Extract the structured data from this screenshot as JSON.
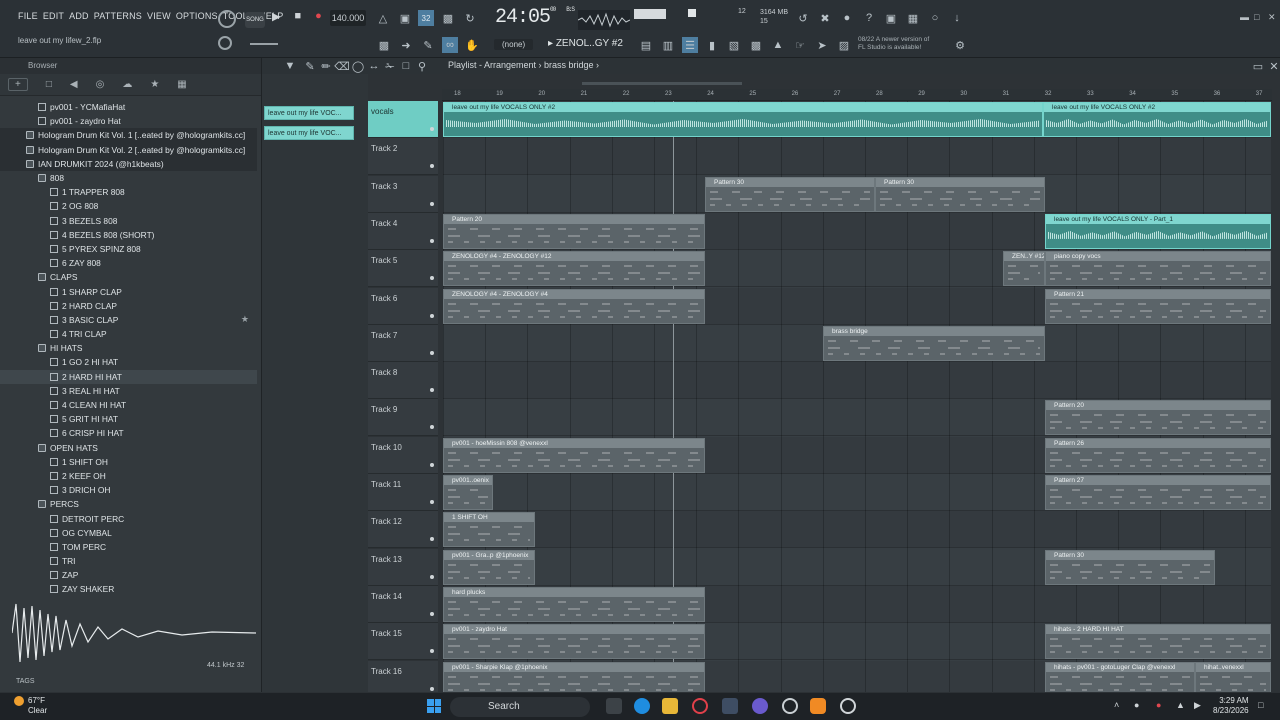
{
  "menu": [
    "FILE",
    "EDIT",
    "ADD",
    "PATTERNS",
    "VIEW",
    "OPTIONS",
    "TOOLS",
    "HELP"
  ],
  "hint_text": "leave out my lifew_2.flp",
  "song_mode_label": "SONG",
  "tempo": "140.000",
  "clock": {
    "main": "24:05",
    "sub": "00",
    "unit": "B:S"
  },
  "cpu": {
    "value": "12",
    "memory": "3164 MB",
    "count": "15"
  },
  "pattern_selector": "ZENOL..GY #2",
  "none_selector": "(none)",
  "news_text": [
    "08/22  A newer version of",
    "FL Studio is available!"
  ],
  "browser": {
    "title": "Browser",
    "items": [
      {
        "label": "pv001 - YCMafiaHat",
        "indent": 2,
        "folder": false
      },
      {
        "label": "pv001 - zaydro Hat",
        "indent": 2,
        "folder": false
      },
      {
        "label": "Hologram Drum Kit Vol. 1 [..eated by @hologramkits.cc]",
        "indent": 1,
        "folder": true
      },
      {
        "label": "Hologram Drum Kit Vol. 2 [..eated by @hologramkits.cc]",
        "indent": 1,
        "folder": true
      },
      {
        "label": "IAN DRUMKIT 2024 (@h1kbeats)",
        "indent": 1,
        "folder": true
      },
      {
        "label": "808",
        "indent": 2,
        "folder": true
      },
      {
        "label": "1 TRAPPER 808",
        "indent": 3,
        "folder": false
      },
      {
        "label": "2 OG 808",
        "indent": 3,
        "folder": false
      },
      {
        "label": "3 BEZELS 808",
        "indent": 3,
        "folder": false
      },
      {
        "label": "4 BEZELS 808 (SHORT)",
        "indent": 3,
        "folder": false
      },
      {
        "label": "5 PYREX SPINZ 808",
        "indent": 3,
        "folder": false
      },
      {
        "label": "6 ZAY 808",
        "indent": 3,
        "folder": false
      },
      {
        "label": "CLAPS",
        "indent": 2,
        "folder": true
      },
      {
        "label": "1 SHARP CLAP",
        "indent": 3,
        "folder": false
      },
      {
        "label": "2 HARD CLAP",
        "indent": 3,
        "folder": false
      },
      {
        "label": "3 BASIC CLAP",
        "indent": 3,
        "folder": false
      },
      {
        "label": "4 TRI CLAP",
        "indent": 3,
        "folder": false
      },
      {
        "label": "HI HATS",
        "indent": 2,
        "folder": true
      },
      {
        "label": "1 GO 2 HI HAT",
        "indent": 3,
        "folder": false
      },
      {
        "label": "2 HARD HI HAT",
        "indent": 3,
        "folder": false
      },
      {
        "label": "3 REAL HI HAT",
        "indent": 3,
        "folder": false
      },
      {
        "label": "4 CLEAN HI HAT",
        "indent": 3,
        "folder": false
      },
      {
        "label": "5 GRIT HI HAT",
        "indent": 3,
        "folder": false
      },
      {
        "label": "6 CRISP HI HAT",
        "indent": 3,
        "folder": false
      },
      {
        "label": "OPEN HATS",
        "indent": 2,
        "folder": true
      },
      {
        "label": "1 SHIFT OH",
        "indent": 3,
        "folder": false
      },
      {
        "label": "2 KEEF OH",
        "indent": 3,
        "folder": false
      },
      {
        "label": "3 DRICH OH",
        "indent": 3,
        "folder": false
      },
      {
        "label": "PERCS",
        "indent": 2,
        "folder": true
      },
      {
        "label": "DETROIT PERC",
        "indent": 3,
        "folder": false
      },
      {
        "label": "OG CYMBAL",
        "indent": 3,
        "folder": false
      },
      {
        "label": "TOM PERC",
        "indent": 3,
        "folder": false
      },
      {
        "label": "TRI",
        "indent": 3,
        "folder": false
      },
      {
        "label": "ZAP",
        "indent": 3,
        "folder": false
      },
      {
        "label": "ZAY SHAKER",
        "indent": 3,
        "folder": false
      }
    ],
    "selected_item": "2 HARD HI HAT",
    "sample_info": "44.1 kHz 32",
    "tags_label": "TAGS"
  },
  "picker": [
    "leave out my life VOC...",
    "leave out my life VOC..."
  ],
  "playlist": {
    "breadcrumb": "Playlist - Arrangement › brass bridge ›",
    "ruler": [
      "18",
      "19",
      "20",
      "21",
      "22",
      "23",
      "24",
      "25",
      "26",
      "27",
      "28",
      "29",
      "30",
      "31",
      "32",
      "33",
      "34",
      "35",
      "36",
      "37"
    ],
    "tracks": [
      "vocals",
      "Track 2",
      "Track 3",
      "Track 4",
      "Track 5",
      "Track 6",
      "Track 7",
      "Track 8",
      "Track 9",
      "Track 10",
      "Track 11",
      "Track 12",
      "Track 13",
      "Track 14",
      "Track 15",
      "Track 16"
    ],
    "clips": [
      {
        "track": 0,
        "start": 0,
        "len": 600,
        "label": "leave out my life VOCALS ONLY #2",
        "type": "audio"
      },
      {
        "track": 0,
        "start": 600,
        "len": 228,
        "label": "leave out my life VOCALS ONLY #2",
        "type": "audio"
      },
      {
        "track": 2,
        "start": 262,
        "len": 170,
        "label": "Pattern 30",
        "type": "pattern"
      },
      {
        "track": 2,
        "start": 432,
        "len": 170,
        "label": "Pattern 30",
        "type": "pattern"
      },
      {
        "track": 3,
        "start": 0,
        "len": 262,
        "label": "Pattern 20",
        "type": "pattern"
      },
      {
        "track": 3,
        "start": 602,
        "len": 226,
        "label": "leave out my life VOCALS ONLY - Part_1",
        "type": "audio"
      },
      {
        "track": 4,
        "start": 0,
        "len": 262,
        "label": "ZENOLOGY #4 - ZENOLOGY #12",
        "type": "pattern"
      },
      {
        "track": 4,
        "start": 560,
        "len": 42,
        "label": "ZEN..Y #12",
        "type": "pattern"
      },
      {
        "track": 4,
        "start": 602,
        "len": 226,
        "label": "piano copy vocs",
        "type": "pattern"
      },
      {
        "track": 5,
        "start": 0,
        "len": 262,
        "label": "ZENOLOGY #4 - ZENOLOGY #4",
        "type": "pattern"
      },
      {
        "track": 5,
        "start": 602,
        "len": 226,
        "label": "Pattern 21",
        "type": "pattern"
      },
      {
        "track": 6,
        "start": 380,
        "len": 222,
        "label": "brass bridge",
        "type": "pattern"
      },
      {
        "track": 8,
        "start": 602,
        "len": 226,
        "label": "Pattern 20",
        "type": "pattern"
      },
      {
        "track": 9,
        "start": 0,
        "len": 262,
        "label": "pv001 - hoeMissin 808 @venexxl",
        "type": "pattern"
      },
      {
        "track": 9,
        "start": 602,
        "len": 226,
        "label": "Pattern 26",
        "type": "pattern"
      },
      {
        "track": 10,
        "start": 0,
        "len": 50,
        "label": "pv001..oenix",
        "type": "pattern"
      },
      {
        "track": 10,
        "start": 602,
        "len": 226,
        "label": "Pattern 27",
        "type": "pattern"
      },
      {
        "track": 11,
        "start": 0,
        "len": 92,
        "label": "1 SHIFT OH",
        "type": "pattern"
      },
      {
        "track": 12,
        "start": 0,
        "len": 92,
        "label": "pv001 - Gra..p @1phoenix",
        "type": "pattern"
      },
      {
        "track": 12,
        "start": 602,
        "len": 170,
        "label": "Pattern 30",
        "type": "pattern"
      },
      {
        "track": 13,
        "start": 0,
        "len": 262,
        "label": "hard plucks",
        "type": "pattern"
      },
      {
        "track": 14,
        "start": 0,
        "len": 262,
        "label": "pv001 - zaydro Hat",
        "type": "pattern"
      },
      {
        "track": 14,
        "start": 602,
        "len": 226,
        "label": "hihats - 2 HARD HI HAT",
        "type": "pattern"
      },
      {
        "track": 15,
        "start": 0,
        "len": 262,
        "label": "pv001 - Sharpie Klap @1phoenix",
        "type": "pattern"
      },
      {
        "track": 15,
        "start": 602,
        "len": 150,
        "label": "hihats - pv001 - gotoLuger Clap @venexxl",
        "type": "pattern"
      },
      {
        "track": 15,
        "start": 752,
        "len": 76,
        "label": "hihat..venexxl",
        "type": "pattern"
      }
    ]
  },
  "taskbar": {
    "weather_temp": "67°F",
    "weather_desc": "Clear",
    "search_placeholder": "Search",
    "time": "3:29 AM",
    "date": "8/23/2026"
  },
  "colors": {
    "accent": "#7fd6cf",
    "background": "#2d3236",
    "clip": "#5b6469"
  }
}
